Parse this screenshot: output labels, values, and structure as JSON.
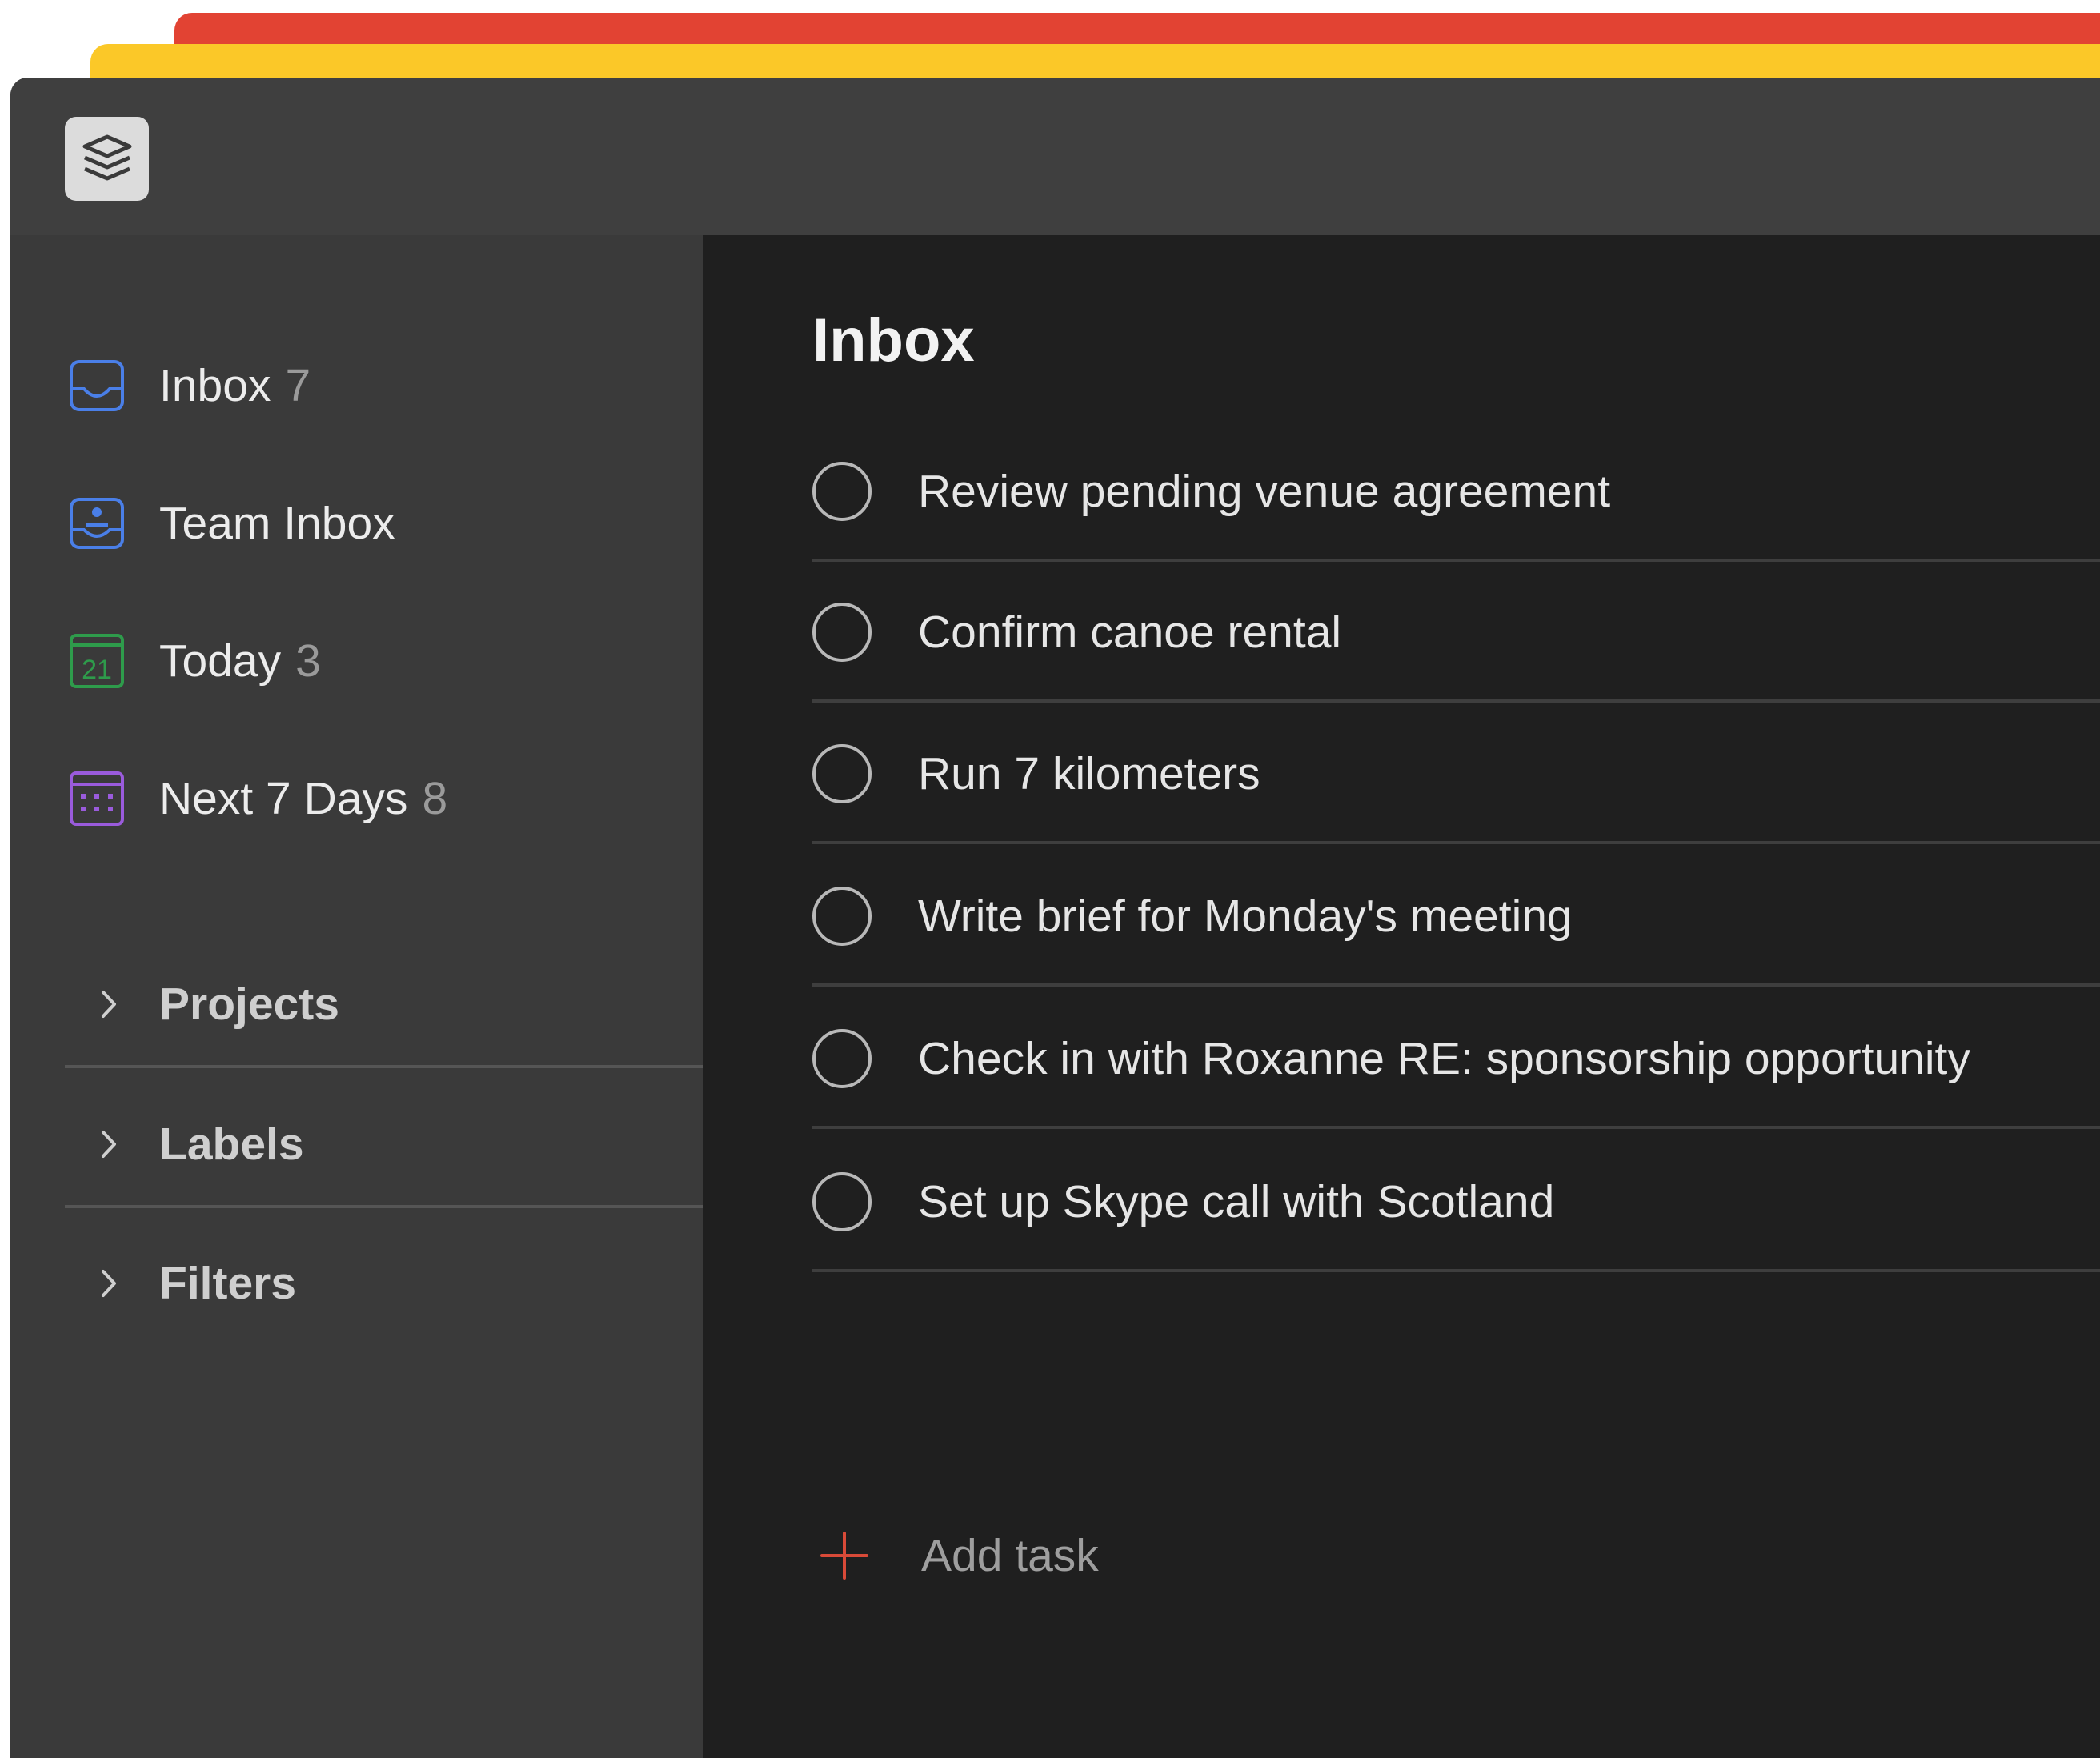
{
  "app": {
    "logo_icon": "todoist-layers-icon"
  },
  "colors": {
    "brand_red": "#e24333",
    "brand_yellow": "#fbc828",
    "inbox_blue": "#4a7fe8",
    "today_green": "#2e9b4b",
    "next7_purple": "#9a5bdc",
    "add_red": "#d84a38"
  },
  "sidebar": {
    "items": [
      {
        "label": "Inbox",
        "count": "7",
        "icon": "inbox-icon"
      },
      {
        "label": "Team Inbox",
        "count": "",
        "icon": "team-inbox-icon"
      },
      {
        "label": "Today",
        "count": "3",
        "icon": "calendar-today-icon",
        "day": "21"
      },
      {
        "label": "Next 7 Days",
        "count": "8",
        "icon": "calendar-week-icon"
      }
    ],
    "sections": [
      {
        "label": "Projects",
        "icon": "chevron-right-icon"
      },
      {
        "label": "Labels",
        "icon": "chevron-right-icon"
      },
      {
        "label": "Filters",
        "icon": "chevron-right-icon"
      }
    ]
  },
  "main": {
    "title": "Inbox",
    "tasks": [
      "Review pending venue agreement",
      "Confirm canoe rental",
      "Run 7 kilometers",
      "Write brief for Monday's meeting",
      "Check in with Roxanne RE: sponsorship opportunity",
      "Set up Skype call with Scotland"
    ],
    "add_task_label": "Add task",
    "add_task_icon": "plus-icon"
  }
}
